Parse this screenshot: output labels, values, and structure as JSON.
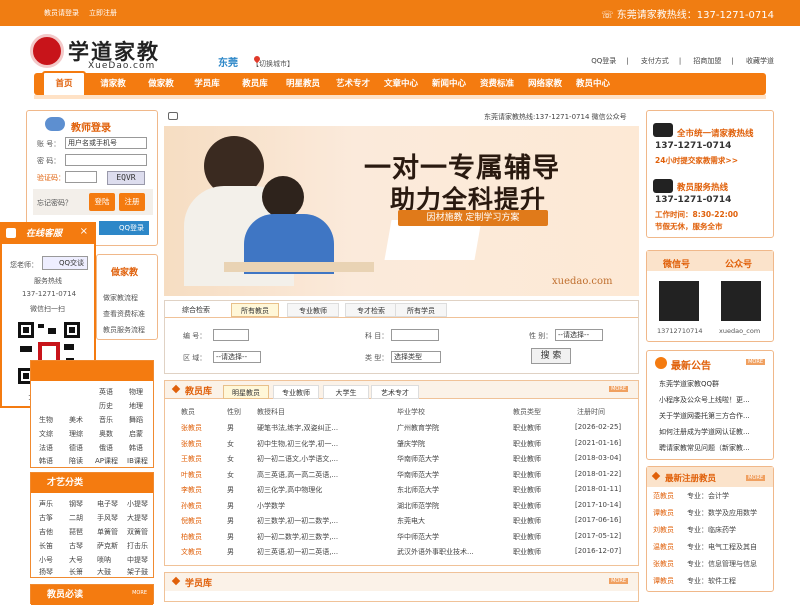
{
  "topbar": {
    "login": "教员请登录",
    "register": "立即注册",
    "hotline": "东莞请家教热线：137-1271-0714"
  },
  "logo": {
    "name": "学道家教",
    "sub": "XueDao.com"
  },
  "city": {
    "name": "东莞",
    "switch": "【切换城市】"
  },
  "header_links": [
    "QQ登录",
    "支付方式",
    "招商加盟",
    "收藏学道"
  ],
  "nav": [
    "首页",
    "请家教",
    "做家教",
    "学员库",
    "教员库",
    "明星教员",
    "艺术专才",
    "文章中心",
    "新闻中心",
    "资费标准",
    "网络家教",
    "教员中心"
  ],
  "login": {
    "title": "教师登录",
    "account_label": "账 号：",
    "account_placeholder": "用户名或手机号",
    "password_label": "密 码：",
    "captcha_label": "验证码：",
    "captcha_text": "EQVR",
    "forgot": "忘记密码？",
    "login_btn": "登陆",
    "register_btn": "注册",
    "qq_btn": "QQ登录"
  },
  "online": {
    "title": "在线客服",
    "teacher_label": "您老师：",
    "qq_label": "QQ交谈",
    "hotline_label": "服务热线",
    "phone": "137-1271-0714",
    "wechat": "微信扫一扫",
    "qr_id": "13712710714"
  },
  "tutor_box": {
    "title": "做家教",
    "items": [
      "做家教流程",
      "查看资费标准",
      "教员服务流程"
    ]
  },
  "subjects": {
    "rows": [
      [
        "",
        "英语",
        "物理"
      ],
      [
        "",
        "历史",
        "地理"
      ],
      [
        "生物",
        "美术",
        "音乐",
        "舞蹈"
      ],
      [
        "文综",
        "理综",
        "奥数",
        "启蒙"
      ],
      [
        "法语",
        "德语",
        "俄语",
        "韩语"
      ],
      [
        "韩语",
        "陪读",
        "AP课程",
        "IB课程"
      ]
    ]
  },
  "art": {
    "title": "才艺分类",
    "rows": [
      [
        "声乐",
        "钢琴",
        "电子琴",
        "小提琴"
      ],
      [
        "古筝",
        "二胡",
        "手风琴",
        "大提琴"
      ],
      [
        "吉他",
        "琵琶",
        "单簧管",
        "双簧管"
      ],
      [
        "长笛",
        "古琴",
        "萨克斯",
        "打击乐"
      ],
      [
        "小号",
        "大号",
        "唢呐",
        "中提琴"
      ],
      [
        "扬琴",
        "长箫",
        "大鼓",
        "架子鼓"
      ]
    ]
  },
  "must_read": {
    "title": "教员必读",
    "more": "MORE"
  },
  "sound_notice": "东莞请家教热线:137-1271-0714 微信公众号",
  "banner": {
    "line1": "一对一专属辅导",
    "line2": "助力全科提升",
    "tag": "因材施教  定制学习方案",
    "site": "xuedao.com"
  },
  "search": {
    "tabs": [
      "综合检索",
      "所有教员",
      "专业教师",
      "专才检索",
      "所有学员"
    ],
    "id_label": "编  号：",
    "subject_label": "科  目：",
    "gender_label": "性  别：",
    "gender_value": "--请选择--",
    "area_label": "区  域：",
    "area_value": "--请选择--",
    "type_label": "类  型：",
    "type_value": "选择类型",
    "search_btn": "搜 索"
  },
  "teachers": {
    "title": "教员库",
    "tabs": [
      "明星教员",
      "专业教师",
      "大学生",
      "艺术专才"
    ],
    "more": "MORE",
    "headers": [
      "教员",
      "性别",
      "教授科目",
      "毕业学校",
      "教员类型",
      "注册时间"
    ],
    "rows": [
      [
        "张教员",
        "男",
        "硬笔书法,练字,双姿纠正...",
        "广州教育学院",
        "职业教师",
        "[2026-02-25]"
      ],
      [
        "张教员",
        "女",
        "初中生物,初三化学,初一...",
        "肇庆学院",
        "职业教师",
        "[2021-01-16]"
      ],
      [
        "王教员",
        "女",
        "初一初二语文,小学语文,...",
        "华南师范大学",
        "职业教师",
        "[2018-03-04]"
      ],
      [
        "叶教员",
        "女",
        "高三英语,高一高二英语,...",
        "华南师范大学",
        "职业教师",
        "[2018-01-22]"
      ],
      [
        "李教员",
        "男",
        "初三化学,高中物理化",
        "东北师范大学",
        "职业教师",
        "[2018-01-11]"
      ],
      [
        "孙教员",
        "男",
        "小学数学",
        "湖北师范学院",
        "职业教师",
        "[2017-10-14]"
      ],
      [
        "倪教员",
        "男",
        "初三数学,初一初二数学,...",
        "东莞电大",
        "职业教师",
        "[2017-06-16]"
      ],
      [
        "柏教员",
        "男",
        "初一初二数学,初三数学,...",
        "华中师范大学",
        "职业教师",
        "[2017-05-12]"
      ],
      [
        "文教员",
        "男",
        "初三英语,初一初二英语,...",
        "武汉外语外事职业技术...",
        "职业教师",
        "[2016-12-07]"
      ]
    ]
  },
  "students": {
    "title": "学员库",
    "more": "MORE"
  },
  "hotline_box": {
    "t1": "全市统一请家教热线",
    "p1": "137-1271-0714",
    "s1": "24小时提交家教需求>>",
    "t2": "教员服务热线",
    "p2": "137-1271-0714",
    "time": "工作时间：8:30-22:00",
    "s2": "节假无休，服务全市"
  },
  "wechat_box": {
    "tab1": "微信号",
    "tab2": "公众号",
    "id1": "13712710714",
    "id2": "xuedao_com"
  },
  "news": {
    "title": "最新公告",
    "more": "MORE",
    "items": [
      "东莞学道家教QQ群",
      "小程序及公众号上线啦！更...",
      "关于学道网委托第三方合作...",
      "如何注册成为学道网认证教...",
      "聘请家教常见问题（新家教..."
    ]
  },
  "new_teachers": {
    "title": "最新注册教员",
    "more": "MORE",
    "items": [
      [
        "范教员",
        "专业：会计学"
      ],
      [
        "谭教员",
        "专业：数学及应用数学"
      ],
      [
        "刘教员",
        "专业：临床药学"
      ],
      [
        "温教员",
        "专业：电气工程及其自"
      ],
      [
        "张教员",
        "专业：信息管理与信息"
      ],
      [
        "谭教员",
        "专业：软件工程"
      ]
    ]
  }
}
